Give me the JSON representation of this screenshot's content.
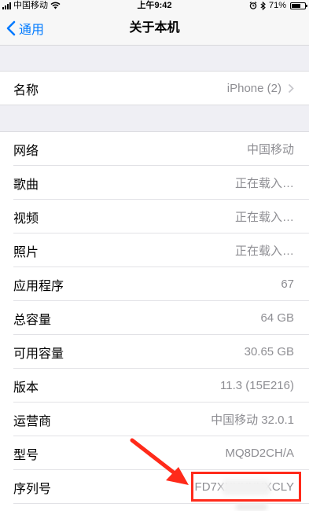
{
  "status_bar": {
    "carrier": "中国移动",
    "time": "上午9:42",
    "battery_percent": "71%",
    "battery_level": 0.71
  },
  "nav": {
    "back_label": "通用",
    "title": "关于本机"
  },
  "name_row": {
    "label": "名称",
    "value": "iPhone (2)"
  },
  "rows": [
    {
      "label": "网络",
      "value": "中国移动"
    },
    {
      "label": "歌曲",
      "value": "正在载入…"
    },
    {
      "label": "视频",
      "value": "正在载入…"
    },
    {
      "label": "照片",
      "value": "正在载入…"
    },
    {
      "label": "应用程序",
      "value": "67"
    },
    {
      "label": "总容量",
      "value": "64 GB"
    },
    {
      "label": "可用容量",
      "value": "30.65 GB"
    },
    {
      "label": "版本",
      "value": "11.3 (15E216)"
    },
    {
      "label": "运营商",
      "value": "中国移动 32.0.1"
    },
    {
      "label": "型号",
      "value": "MQ8D2CH/A"
    },
    {
      "label": "序列号",
      "value": "FD7XXXXXXXCLY"
    }
  ],
  "colors": {
    "accent": "#007aff",
    "annotation": "#ff2a1a",
    "secondary_text": "#8e8e93"
  }
}
